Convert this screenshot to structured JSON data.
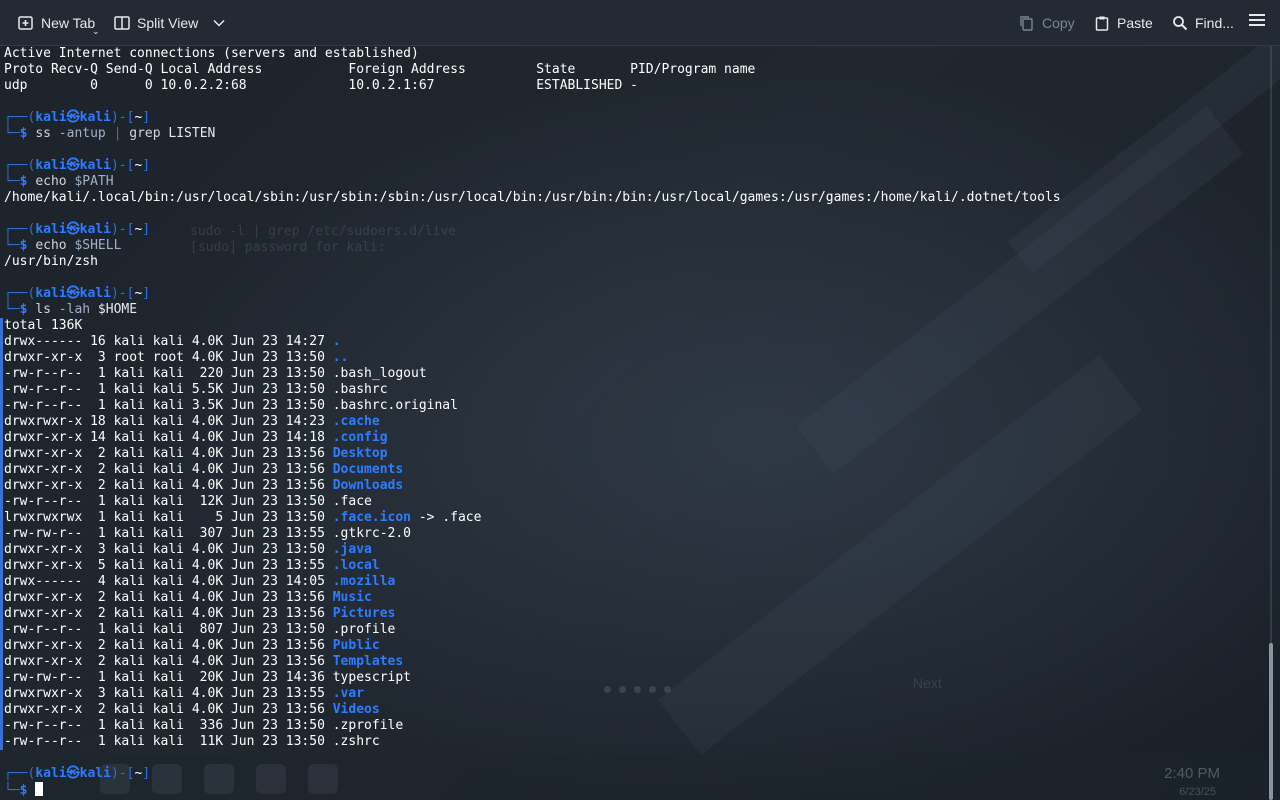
{
  "toolbar": {
    "new_tab": "New Tab",
    "split_view": "Split View",
    "copy": "Copy",
    "paste": "Paste",
    "find": "Find..."
  },
  "colors": {
    "background": "#1b2129",
    "toolbar": "#232a33",
    "directory": "#2f7dff",
    "prompt": "#2f6fd6",
    "text": "#ffffff"
  },
  "terminal": {
    "netstat_lines": [
      "Active Internet connections (servers and established)",
      "Proto Recv-Q Send-Q Local Address           Foreign Address         State       PID/Program name",
      "udp        0      0 10.0.2.2:68             10.0.2.1:67             ESTABLISHED -"
    ],
    "prompt": {
      "user": "kali",
      "host": "kali",
      "cwd": "~",
      "symbol": "$"
    },
    "commands": [
      {
        "cmd": "ss",
        "args": " -antup ",
        "pipe": "|",
        "rest": " grep",
        "tail": " LISTEN"
      },
      {
        "cmd": "echo",
        "args": " $PATH"
      },
      {
        "cmd": "echo",
        "args": " $SHELL"
      },
      {
        "cmd": "ls",
        "args": " -lah",
        "tail": " $HOME"
      }
    ],
    "path_output": "/home/kali/.local/bin:/usr/local/sbin:/usr/sbin:/sbin:/usr/local/bin:/usr/bin:/bin:/usr/local/games:/usr/games:/home/kali/.dotnet/tools",
    "shell_output": "/usr/bin/zsh",
    "ls_total": "total 136K",
    "ls_rows": [
      {
        "meta": "drwx------ 16 kali kali 4.0K Jun 23 14:27 ",
        "name": ".",
        "dir": true
      },
      {
        "meta": "drwxr-xr-x  3 root root 4.0K Jun 23 13:50 ",
        "name": "..",
        "dir": true
      },
      {
        "meta": "-rw-r--r--  1 kali kali  220 Jun 23 13:50 ",
        "name": ".bash_logout",
        "dir": false
      },
      {
        "meta": "-rw-r--r--  1 kali kali 5.5K Jun 23 13:50 ",
        "name": ".bashrc",
        "dir": false
      },
      {
        "meta": "-rw-r--r--  1 kali kali 3.5K Jun 23 13:50 ",
        "name": ".bashrc.original",
        "dir": false
      },
      {
        "meta": "drwxrwxr-x 18 kali kali 4.0K Jun 23 14:23 ",
        "name": ".cache",
        "dir": true
      },
      {
        "meta": "drwxr-xr-x 14 kali kali 4.0K Jun 23 14:18 ",
        "name": ".config",
        "dir": true
      },
      {
        "meta": "drwxr-xr-x  2 kali kali 4.0K Jun 23 13:56 ",
        "name": "Desktop",
        "dir": true
      },
      {
        "meta": "drwxr-xr-x  2 kali kali 4.0K Jun 23 13:56 ",
        "name": "Documents",
        "dir": true
      },
      {
        "meta": "drwxr-xr-x  2 kali kali 4.0K Jun 23 13:56 ",
        "name": "Downloads",
        "dir": true
      },
      {
        "meta": "-rw-r--r--  1 kali kali  12K Jun 23 13:50 ",
        "name": ".face",
        "dir": false
      },
      {
        "meta": "lrwxrwxrwx  1 kali kali    5 Jun 23 13:50 ",
        "name": ".face.icon",
        "dir": true,
        "link": " -> .face"
      },
      {
        "meta": "-rw-rw-r--  1 kali kali  307 Jun 23 13:55 ",
        "name": ".gtkrc-2.0",
        "dir": false
      },
      {
        "meta": "drwxr-xr-x  3 kali kali 4.0K Jun 23 13:50 ",
        "name": ".java",
        "dir": true
      },
      {
        "meta": "drwxr-xr-x  5 kali kali 4.0K Jun 23 13:55 ",
        "name": ".local",
        "dir": true
      },
      {
        "meta": "drwx------  4 kali kali 4.0K Jun 23 14:05 ",
        "name": ".mozilla",
        "dir": true
      },
      {
        "meta": "drwxr-xr-x  2 kali kali 4.0K Jun 23 13:56 ",
        "name": "Music",
        "dir": true
      },
      {
        "meta": "drwxr-xr-x  2 kali kali 4.0K Jun 23 13:56 ",
        "name": "Pictures",
        "dir": true
      },
      {
        "meta": "-rw-r--r--  1 kali kali  807 Jun 23 13:50 ",
        "name": ".profile",
        "dir": false
      },
      {
        "meta": "drwxr-xr-x  2 kali kali 4.0K Jun 23 13:56 ",
        "name": "Public",
        "dir": true
      },
      {
        "meta": "drwxr-xr-x  2 kali kali 4.0K Jun 23 13:56 ",
        "name": "Templates",
        "dir": true
      },
      {
        "meta": "-rw-rw-r--  1 kali kali  20K Jun 23 14:36 ",
        "name": "typescript",
        "dir": false
      },
      {
        "meta": "drwxrwxr-x  3 kali kali 4.0K Jun 23 13:55 ",
        "name": ".var",
        "dir": true
      },
      {
        "meta": "drwxr-xr-x  2 kali kali 4.0K Jun 23 13:56 ",
        "name": "Videos",
        "dir": true
      },
      {
        "meta": "-rw-r--r--  1 kali kali  336 Jun 23 13:50 ",
        "name": ".zprofile",
        "dir": false
      },
      {
        "meta": "-rw-r--r--  1 kali kali  11K Jun 23 13:50 ",
        "name": ".zshrc",
        "dir": false
      }
    ]
  },
  "background_ghost": {
    "ghost_cmd": "sudo -l | grep /etc/sudoers.d/live",
    "ghost_prompt": "[sudo] password for kali:",
    "next": "Next",
    "clock_time": "2:40 PM",
    "clock_date": "6/23/25"
  }
}
